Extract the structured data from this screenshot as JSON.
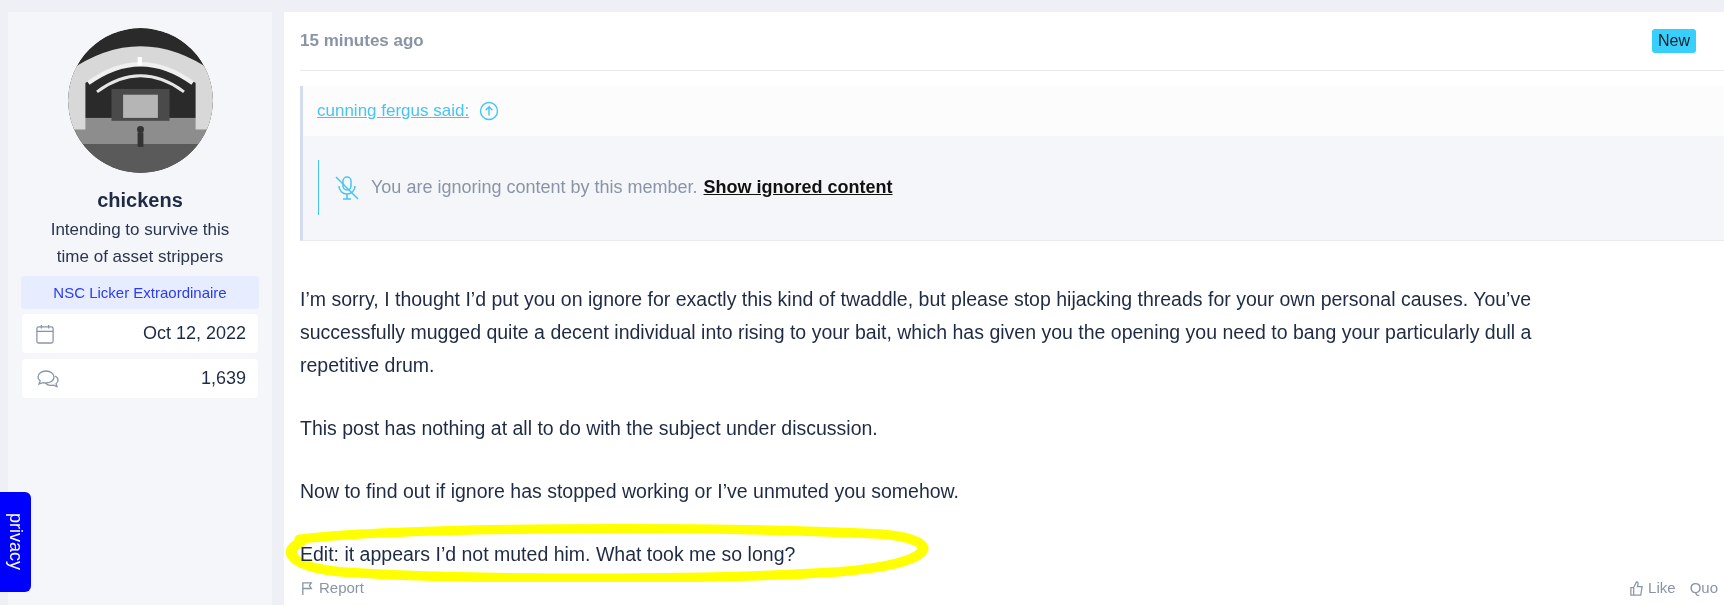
{
  "author": {
    "name": "chickens",
    "title": "Intending to survive this time of asset strippers",
    "banner": "NSC Licker Extraordinaire",
    "stats": [
      {
        "kind": "joined",
        "value": "Oct 12, 2022"
      },
      {
        "kind": "messages",
        "value": "1,639"
      }
    ]
  },
  "post": {
    "time": "15 minutes ago",
    "badge": "New",
    "quote": {
      "source": "cunning fergus said:",
      "ignored_text": "You are ignoring content by this member.",
      "ignored_link": "Show ignored content"
    },
    "paragraphs": [
      {
        "lines": [
          "I’m sorry, I thought I’d put you on ignore for exactly this kind of twaddle, but please stop hijacking threads for your own personal causes. You’ve",
          "successfully mugged quite a decent individual into rising to your bait, which has given you the opening you need to bang your particularly dull a",
          "repetitive drum."
        ]
      },
      {
        "lines": [
          "This post has nothing at all to do with the subject under discussion."
        ]
      },
      {
        "lines": [
          "Now to find out if ignore has stopped working or I’ve unmuted you somehow."
        ]
      },
      {
        "lines": [
          "Edit: it appears I’d not muted him. What took me so long?"
        ],
        "highlighted": true
      }
    ],
    "actions": [
      {
        "kind": "report",
        "label": "Report"
      },
      {
        "kind": "like",
        "label": "Like"
      },
      {
        "kind": "quote",
        "label": "Quo"
      }
    ]
  },
  "privacy_tab": "privacy"
}
